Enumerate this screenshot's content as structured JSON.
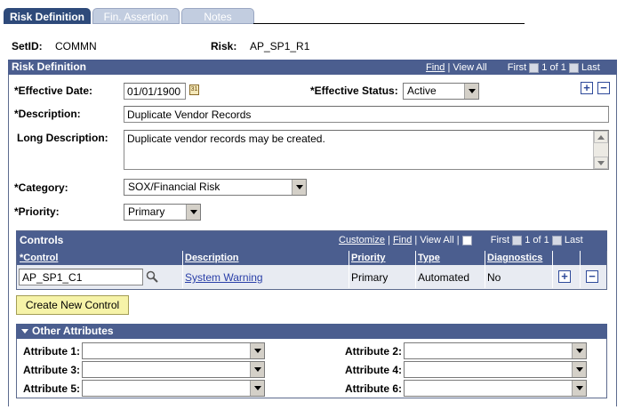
{
  "tabs": [
    {
      "label": "Risk Definition"
    },
    {
      "label": "Fin. Assertion"
    },
    {
      "label": "Notes"
    }
  ],
  "header": {
    "setid_label": "SetID:",
    "setid_value": "COMMN",
    "risk_label": "Risk:",
    "risk_value": "AP_SP1_R1"
  },
  "risk_def": {
    "title": "Risk Definition",
    "nav": {
      "find": "Find",
      "view_all": "View All",
      "first": "First",
      "count": "1 of 1",
      "last": "Last",
      "sep": "|"
    },
    "effective_date_label": "*Effective Date:",
    "effective_date": "01/01/1900",
    "effective_status_label": "*Effective Status:",
    "effective_status": "Active",
    "description_label": "*Description:",
    "description": "Duplicate Vendor Records",
    "long_description_label": "Long Description:",
    "long_description": "Duplicate vendor records may be created.",
    "category_label": "*Category:",
    "category": "SOX/Financial Risk",
    "priority_label": "*Priority:",
    "priority": "Primary"
  },
  "controls": {
    "title": "Controls",
    "nav": {
      "customize": "Customize",
      "find": "Find",
      "view_all": "View All",
      "first": "First",
      "count": "1 of 1",
      "last": "Last",
      "sep": "|"
    },
    "columns": [
      "*Control",
      "Description",
      "Priority",
      "Type",
      "Diagnostics"
    ],
    "row": {
      "control": "AP_SP1_C1",
      "description": "System Warning",
      "priority": "Primary",
      "type": "Automated",
      "diagnostics": "No"
    }
  },
  "create_control_label": "Create New Control",
  "other_attributes": {
    "title": "Other Attributes",
    "labels": [
      "Attribute 1:",
      "Attribute 2:",
      "Attribute 3:",
      "Attribute 4:",
      "Attribute 5:",
      "Attribute 6:"
    ]
  },
  "colors": {
    "header_bg": "#4b5e8f",
    "tab_active": "#2e4a7a",
    "tab_inactive": "#c2cde0",
    "button_bg": "#f6f3a8",
    "row_bg": "#e8ebf2"
  }
}
